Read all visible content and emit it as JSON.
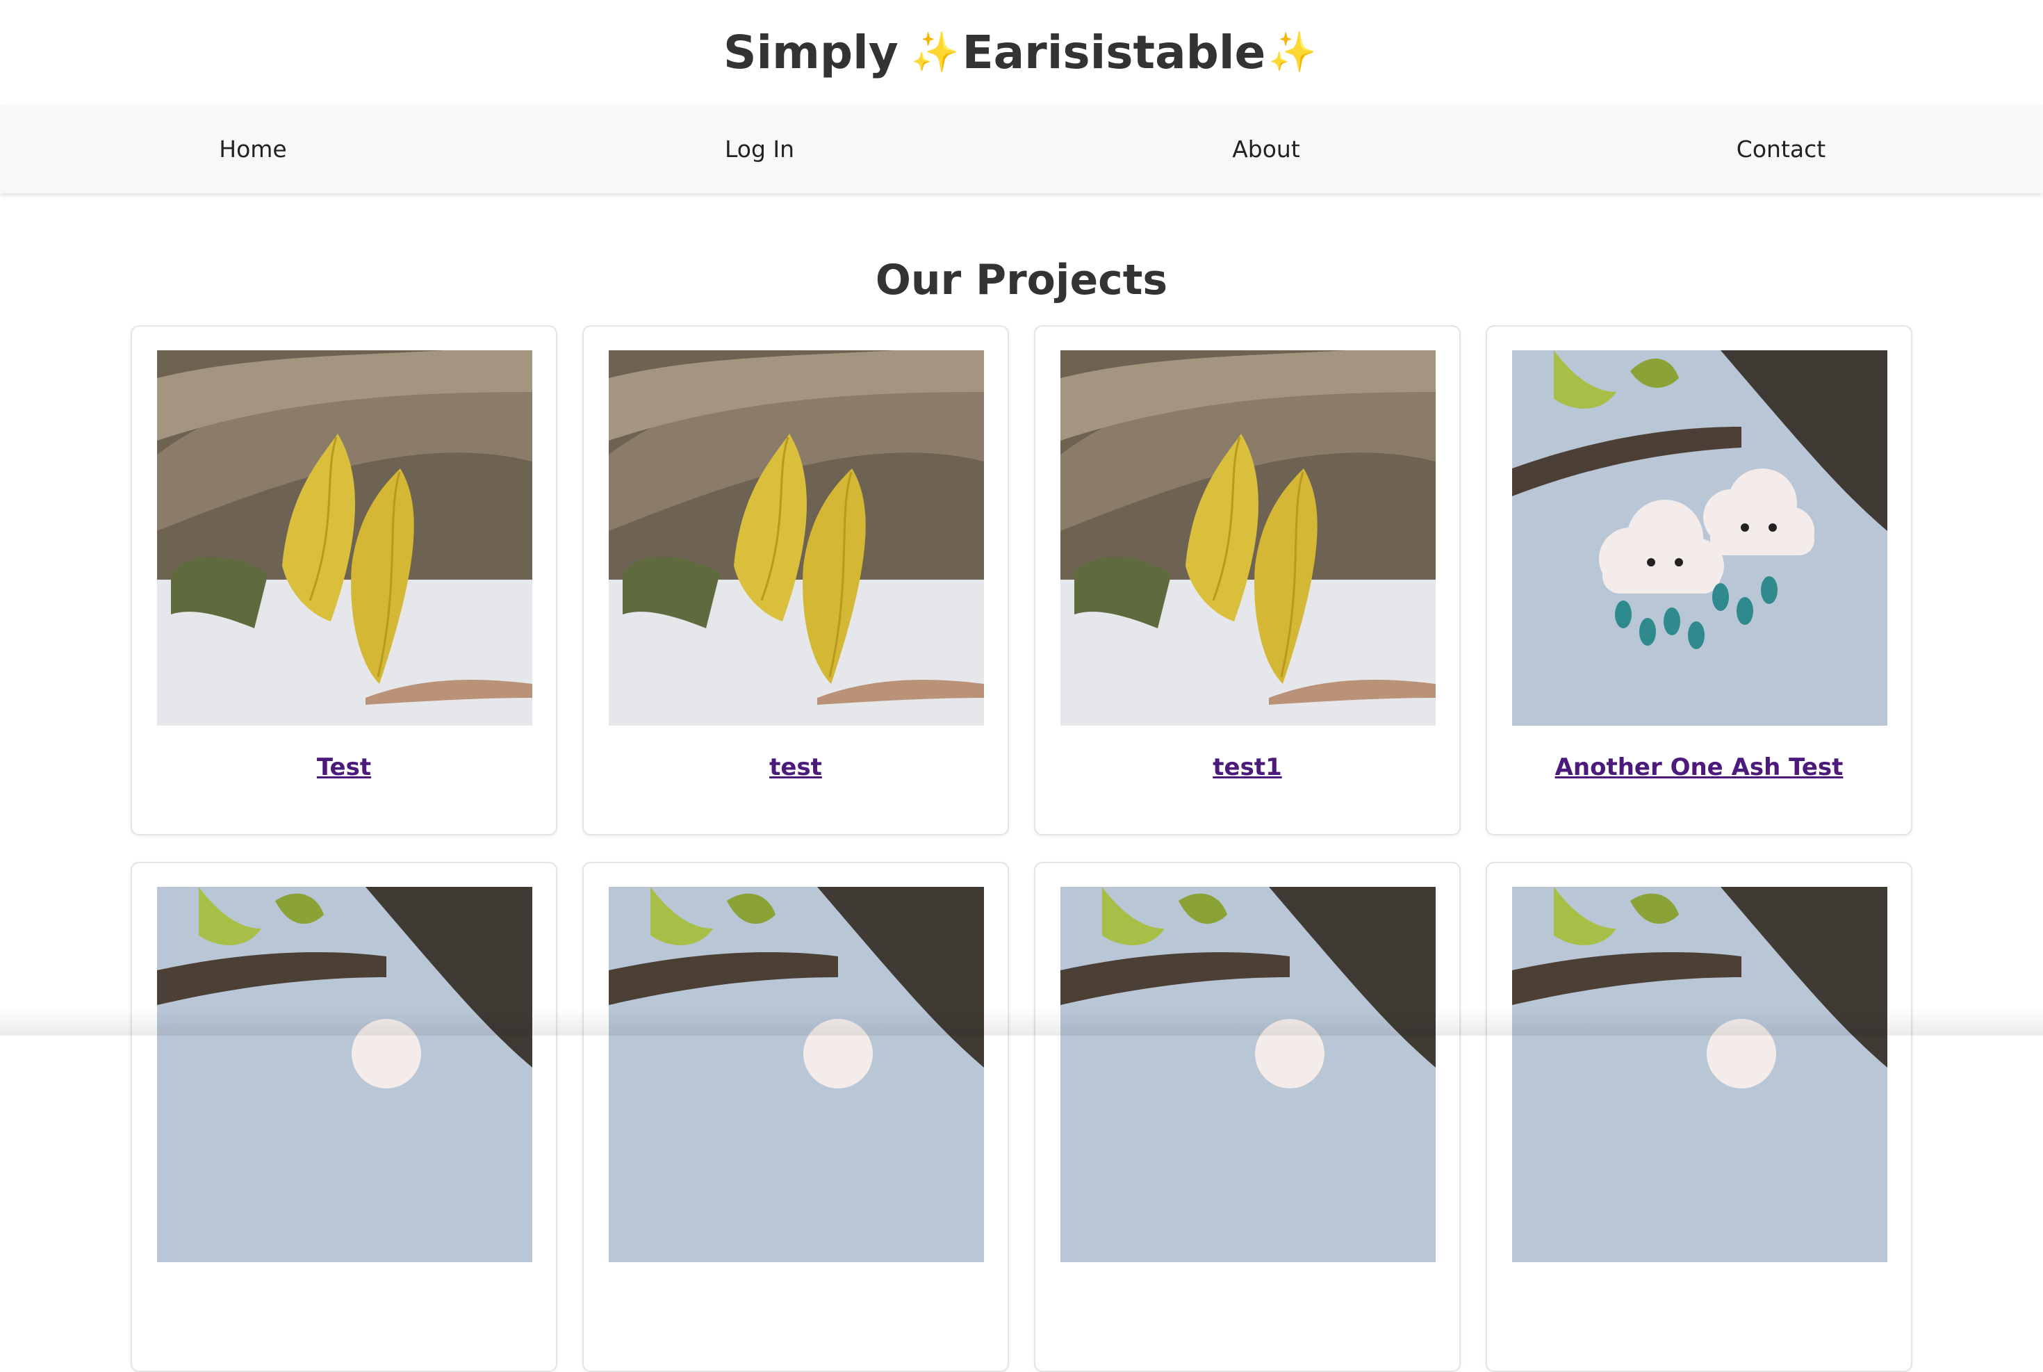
{
  "header": {
    "title_part1": "Simply",
    "title_part2": "Earisistable",
    "sparkle_glyph": "✨"
  },
  "nav": {
    "home": "Home",
    "login": "Log In",
    "about": "About",
    "contact": "Contact"
  },
  "main": {
    "heading": "Our Projects",
    "projects": [
      {
        "title": "Test",
        "image": "gold-leaf-earrings-photo"
      },
      {
        "title": "test",
        "image": "gold-leaf-earrings-photo"
      },
      {
        "title": "test1",
        "image": "gold-leaf-earrings-photo"
      },
      {
        "title": "Another One Ash Test",
        "image": "cloud-raindrop-earrings-photo"
      },
      {
        "title": "",
        "image": "cloud-raindrop-earrings-photo"
      },
      {
        "title": "",
        "image": "cloud-raindrop-earrings-photo"
      },
      {
        "title": "",
        "image": "cloud-raindrop-earrings-photo"
      },
      {
        "title": "",
        "image": "cloud-raindrop-earrings-photo"
      }
    ]
  },
  "colors": {
    "link": "#4b1a7a",
    "nav_bg": "#f7f8fa",
    "sparkle": "#f2c94c"
  }
}
